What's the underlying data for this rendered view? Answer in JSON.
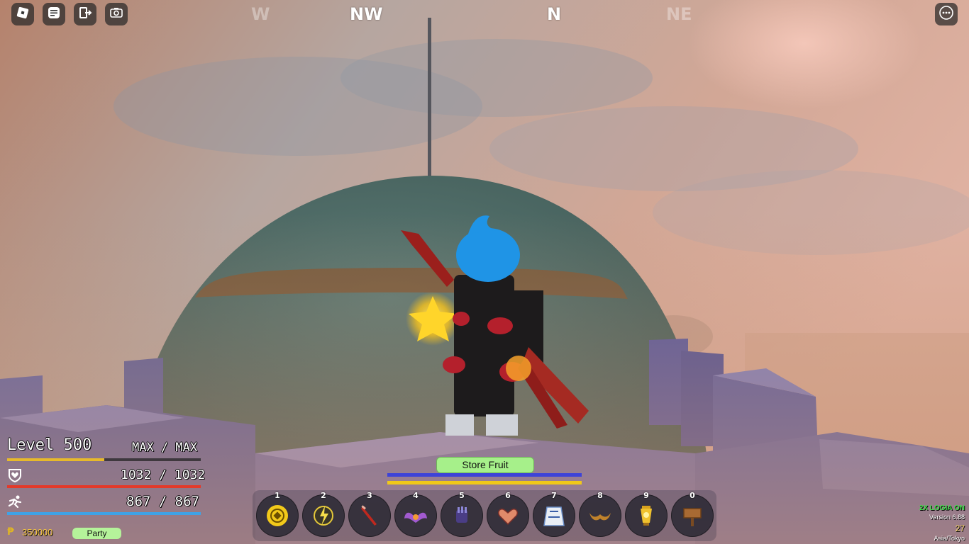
{
  "compass": {
    "w": "W",
    "nw": "NW",
    "n": "N",
    "ne": "NE"
  },
  "top_left_buttons": [
    {
      "name": "roblox-menu-button",
      "icon": "roblox-logo-icon"
    },
    {
      "name": "chat-button",
      "icon": "chat-icon"
    },
    {
      "name": "leave-button",
      "icon": "exit-icon"
    },
    {
      "name": "screenshot-button",
      "icon": "camera-icon"
    }
  ],
  "top_right": {
    "icon": "more-options-icon"
  },
  "stats": {
    "level_label": "Level 500",
    "exp_label": "MAX / MAX",
    "exp_fraction": 0.5,
    "health_label": "1032 / 1032",
    "health_fraction": 1.0,
    "energy_label": "867 / 867",
    "energy_fraction": 1.0,
    "money": "350000",
    "party_label": "Party"
  },
  "store_fruit": {
    "label": "Store Fruit"
  },
  "center_bars": {
    "blue_fraction": 1.0,
    "yellow_fraction": 1.0
  },
  "hotbar": [
    {
      "key": "1",
      "icon": "yellow-fruit-icon"
    },
    {
      "key": "2",
      "icon": "lightning-orb-icon"
    },
    {
      "key": "3",
      "icon": "red-sword-icon"
    },
    {
      "key": "4",
      "icon": "phoenix-wings-icon"
    },
    {
      "key": "5",
      "icon": "dark-fist-icon"
    },
    {
      "key": "6",
      "icon": "heart-wing-icon"
    },
    {
      "key": "7",
      "icon": "cape-icon"
    },
    {
      "key": "8",
      "icon": "horns-icon"
    },
    {
      "key": "9",
      "icon": "golden-lantern-icon"
    },
    {
      "key": "0",
      "icon": "wooden-sign-icon"
    }
  ],
  "bottom_right": {
    "logia": "2X LOGIA ON",
    "version": "Version 6.88",
    "ping": "27",
    "region": "Asia/Tokyo"
  },
  "colors": {
    "exp_bar": "#e7b92b",
    "health_bar": "#e33a2a",
    "energy_bar": "#3fa2e6",
    "store_button": "#a6f08a",
    "party_button": "#b5f39a",
    "logia_text": "#3ee04a",
    "money_icon": "#e0b524"
  }
}
